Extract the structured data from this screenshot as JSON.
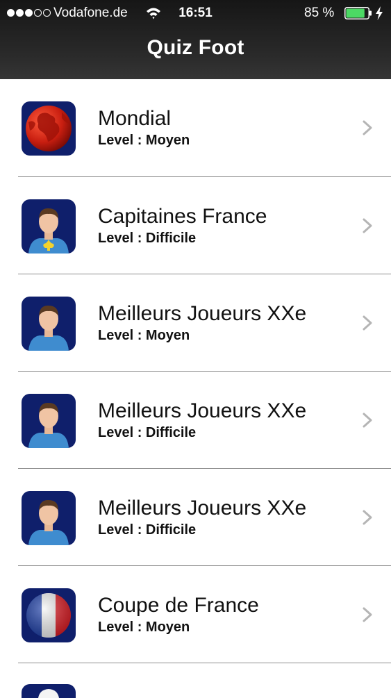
{
  "status_bar": {
    "carrier": "Vodafone.de",
    "time": "16:51",
    "battery": "85 %",
    "battery_level": 0.85,
    "signal_bars_filled": 3,
    "signal_bars_total": 5
  },
  "nav": {
    "title": "Quiz Foot"
  },
  "quizzes": [
    {
      "title": "Mondial",
      "level": "Level : Moyen",
      "icon": "globe-icon"
    },
    {
      "title": "Capitaines France",
      "level": "Level : Difficile",
      "icon": "player-fleur-de-lis-icon"
    },
    {
      "title": "Meilleurs Joueurs XXe",
      "level": "Level : Moyen",
      "icon": "player-icon"
    },
    {
      "title": "Meilleurs Joueurs XXe",
      "level": "Level : Difficile",
      "icon": "player-icon"
    },
    {
      "title": "Meilleurs Joueurs XXe",
      "level": "Level : Difficile",
      "icon": "player-icon"
    },
    {
      "title": "Coupe de France",
      "level": "Level : Moyen",
      "icon": "france-flag-ball-icon"
    }
  ],
  "colors": {
    "nav_background": "#1f1f1f",
    "icon_background": "#0f1f6b",
    "battery_green": "#4cd964",
    "chevron": "#b5b5b5",
    "separator": "#8c8c8c"
  }
}
